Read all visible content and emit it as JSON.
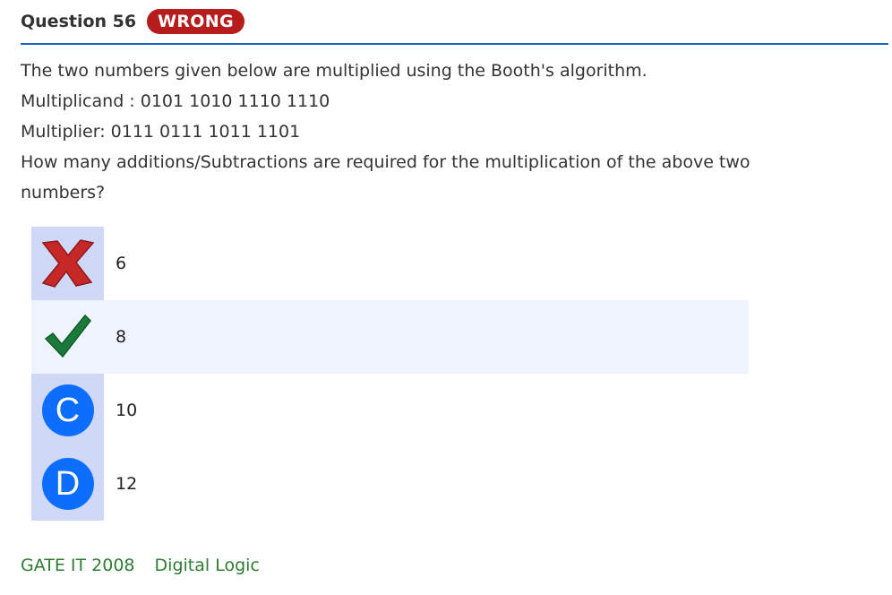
{
  "question": {
    "title": "Question 56",
    "status_badge": "WRONG",
    "lines": [
      "The two numbers given below are multiplied using the Booth's algorithm.",
      "Multiplicand : 0101 1010 1110 1110",
      "Multiplier: 0111 0111 1011 1101",
      "How many additions/Subtractions are required for the multiplication of the above two numbers?"
    ]
  },
  "options": [
    {
      "marker": "wrong-x",
      "text": "6",
      "state": "selected-wrong"
    },
    {
      "marker": "correct-check",
      "text": "8",
      "state": "correct"
    },
    {
      "marker": "C",
      "text": "10",
      "state": "normal"
    },
    {
      "marker": "D",
      "text": "12",
      "state": "normal"
    }
  ],
  "tags": [
    "GATE IT 2008",
    "Digital Logic"
  ],
  "colors": {
    "accent": "#1565c0",
    "badge": "#b71c1c",
    "tag_text": "#2e7d32",
    "option_letter": "#0d6efd",
    "highlight_bg": "#eef3fe",
    "marker_bg": "#cfd8f7"
  }
}
